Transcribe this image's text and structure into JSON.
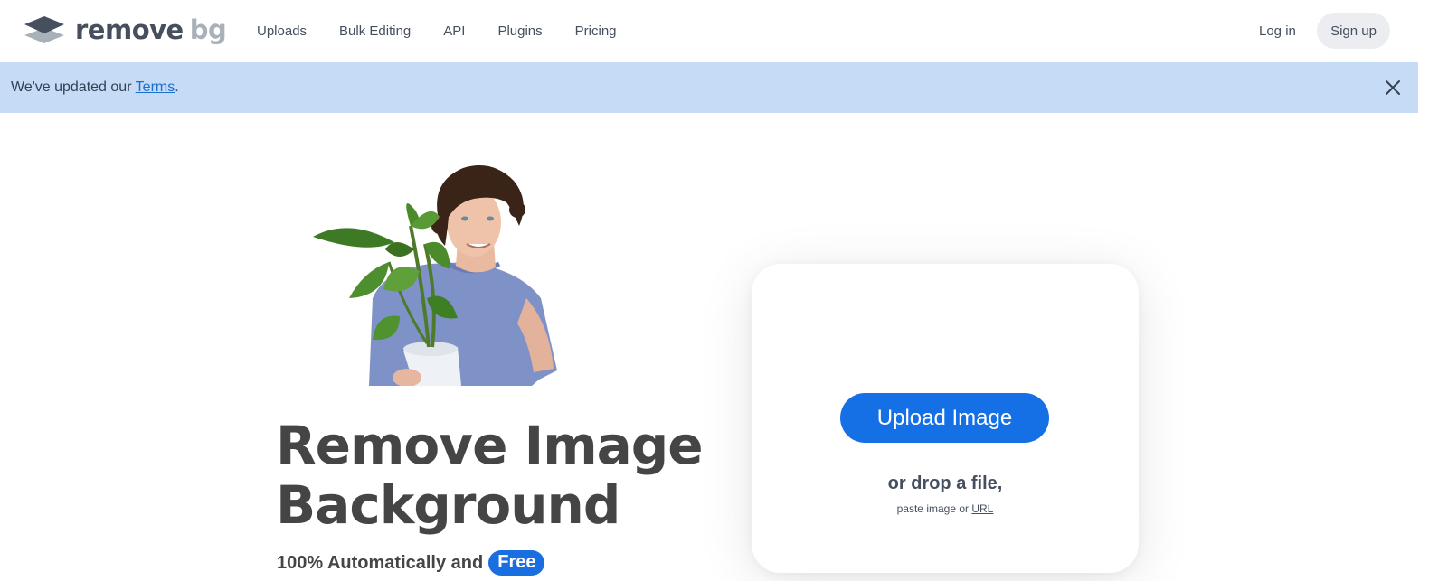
{
  "brand": {
    "word1": "remove",
    "word2": "bg",
    "colors": {
      "dark": "#454f5e",
      "light": "#a8b0ba"
    }
  },
  "nav": {
    "items": [
      {
        "label": "Uploads"
      },
      {
        "label": "Bulk Editing"
      },
      {
        "label": "API"
      },
      {
        "label": "Plugins"
      },
      {
        "label": "Pricing"
      }
    ],
    "login_label": "Log in",
    "signup_label": "Sign up"
  },
  "banner": {
    "text_before": "We've updated our ",
    "link_text": "Terms",
    "text_after": ".",
    "close_icon": "close-icon",
    "background": "#c5dbf6"
  },
  "hero": {
    "title_line1": "Remove Image",
    "title_line2": "Background",
    "subtitle": "100% Automatically and",
    "badge": "Free",
    "badge_color": "#1a6fe0"
  },
  "upload": {
    "button_label": "Upload Image",
    "drop_text": "or drop a file,",
    "paste_text": "paste image or ",
    "url_link": "URL",
    "button_color": "#1570e6"
  }
}
